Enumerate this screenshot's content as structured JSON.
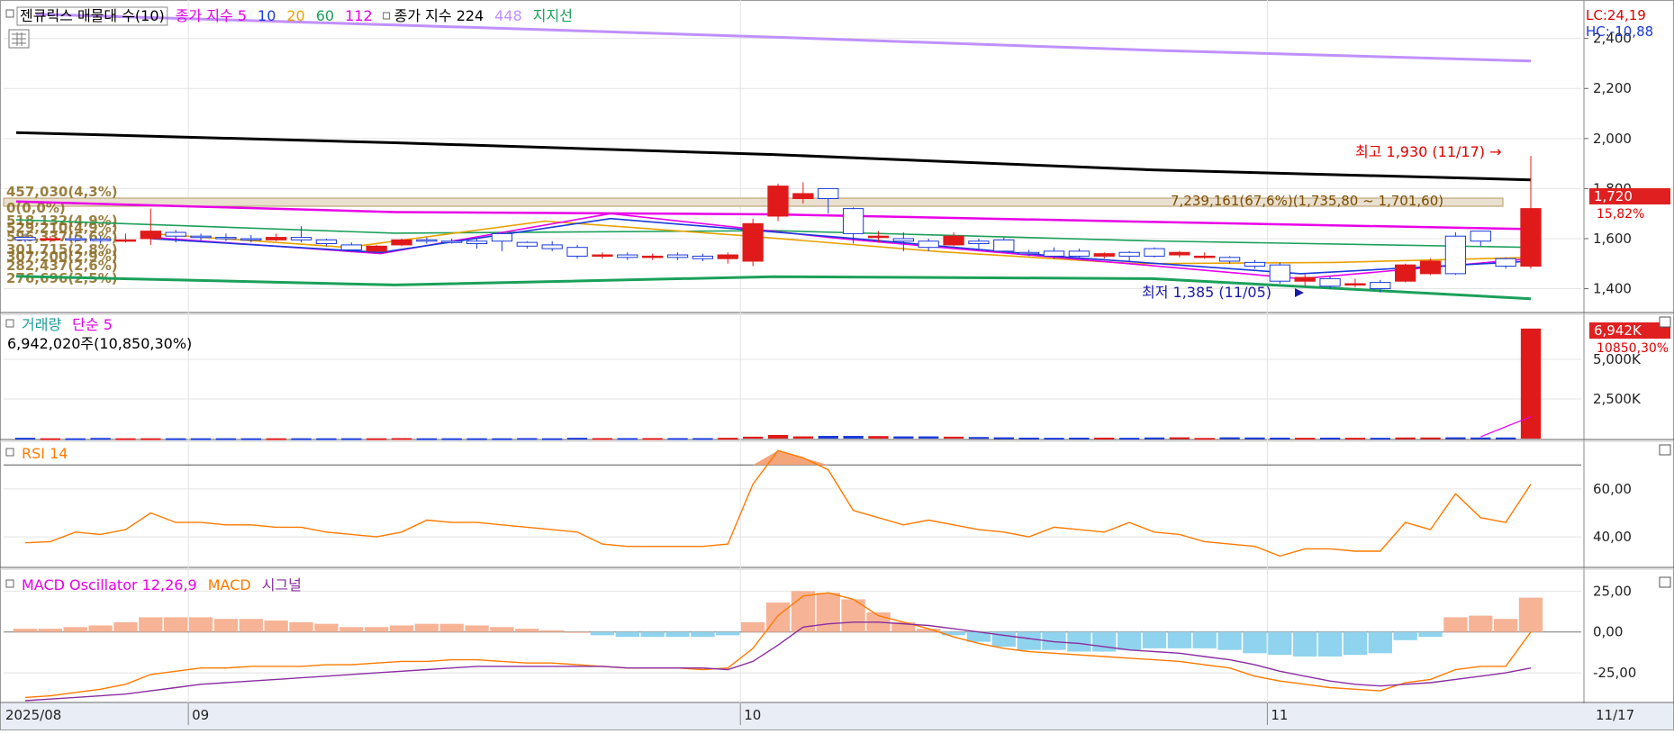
{
  "price_panel": {
    "legend": [
      {
        "text": "젠큐릭스 매물대 수(10)",
        "color": "#000000",
        "boxed": true
      },
      {
        "text": "종가 지수 5",
        "color": "#e800e8"
      },
      {
        "text": "10",
        "color": "#1a3adb"
      },
      {
        "text": "20",
        "color": "#e8a200"
      },
      {
        "text": "60",
        "color": "#1ba05a"
      },
      {
        "text": "112",
        "color": "#e800e8"
      },
      {
        "text": "종가 지수 224",
        "color": "#000000",
        "marker": true
      },
      {
        "text": "448",
        "color": "#c090ff"
      },
      {
        "text": "지지선",
        "color": "#1ba05a"
      }
    ],
    "lc_label": "LC:24,19",
    "hc_label": "HC:-10,88",
    "current_price": "1,720",
    "current_change": "15,82%",
    "high_note": "최고 1,930 (11/17) →",
    "low_note": "최저 1,385 (11/05)",
    "volume_profile_note": "7,239,161(67,6%)(1,735,80 ~ 1,701,60)",
    "volume_profile_labels": [
      "457,030(4,3%)",
      "0(0,0%)",
      "518,132(4,9%)",
      "529,210(4,9%)",
      "596,337(5,6%)",
      "301,715(2,8%)",
      "307,200(2,9%)",
      "282,437(2,6%)",
      "276,696(2,5%)"
    ]
  },
  "volume_panel": {
    "legend": [
      {
        "text": "거래량",
        "color": "#1a9a9a"
      },
      {
        "text": "단순 5",
        "color": "#e800e8"
      }
    ],
    "value_text": "6,942,020주(10,850,30%)",
    "badge": "6,942K",
    "badge_sub": "10850,30%"
  },
  "rsi_panel": {
    "legend": [
      {
        "text": "RSI 14",
        "color": "#ff7a00"
      }
    ]
  },
  "macd_panel": {
    "legend": [
      {
        "text": "MACD Oscillator 12,26,9",
        "color": "#e800e8"
      },
      {
        "text": "MACD",
        "color": "#ff7a00"
      },
      {
        "text": "시그널",
        "color": "#8a2da0"
      }
    ]
  },
  "x_axis": {
    "labels": [
      "2025/08",
      "09",
      "10",
      "11"
    ],
    "end_label": "11/17"
  },
  "chart_data": [
    {
      "type": "candlestick",
      "title": "젠큐릭스 일봉",
      "ylim": [
        1330,
        2460
      ],
      "y_ticks": [
        1400,
        1600,
        1800,
        2000,
        2200,
        2400
      ],
      "y_tick_labels": [
        "1,400",
        "1,600",
        "1,800",
        "2,000",
        "2,200",
        "2,400"
      ],
      "candles": [
        [
          1605,
          1595,
          1620,
          1585
        ],
        [
          1595,
          1600,
          1610,
          1585
        ],
        [
          1600,
          1595,
          1615,
          1585
        ],
        [
          1598,
          1592,
          1610,
          1580
        ],
        [
          1592,
          1595,
          1620,
          1585
        ],
        [
          1600,
          1630,
          1720,
          1575
        ],
        [
          1625,
          1610,
          1635,
          1585
        ],
        [
          1610,
          1605,
          1620,
          1585
        ],
        [
          1605,
          1600,
          1620,
          1590
        ],
        [
          1600,
          1595,
          1615,
          1585
        ],
        [
          1595,
          1605,
          1620,
          1590
        ],
        [
          1605,
          1595,
          1650,
          1585
        ],
        [
          1595,
          1580,
          1600,
          1570
        ],
        [
          1575,
          1555,
          1585,
          1545
        ],
        [
          1550,
          1570,
          1575,
          1545
        ],
        [
          1575,
          1595,
          1600,
          1570
        ],
        [
          1595,
          1590,
          1605,
          1580
        ],
        [
          1590,
          1588,
          1600,
          1580
        ],
        [
          1590,
          1580,
          1600,
          1560
        ],
        [
          1620,
          1590,
          1625,
          1550
        ],
        [
          1585,
          1570,
          1590,
          1560
        ],
        [
          1575,
          1560,
          1590,
          1550
        ],
        [
          1565,
          1530,
          1575,
          1520
        ],
        [
          1530,
          1535,
          1545,
          1520
        ],
        [
          1535,
          1525,
          1545,
          1515
        ],
        [
          1530,
          1530,
          1540,
          1515
        ],
        [
          1535,
          1525,
          1545,
          1515
        ],
        [
          1530,
          1520,
          1540,
          1510
        ],
        [
          1520,
          1535,
          1545,
          1500
        ],
        [
          1510,
          1660,
          1680,
          1490
        ],
        [
          1690,
          1810,
          1820,
          1670
        ],
        [
          1760,
          1780,
          1825,
          1740
        ],
        [
          1800,
          1760,
          1800,
          1700
        ],
        [
          1720,
          1620,
          1725,
          1580
        ],
        [
          1610,
          1610,
          1630,
          1585
        ],
        [
          1600,
          1590,
          1625,
          1550
        ],
        [
          1590,
          1565,
          1600,
          1550
        ],
        [
          1575,
          1610,
          1625,
          1570
        ],
        [
          1590,
          1580,
          1600,
          1560
        ],
        [
          1595,
          1550,
          1605,
          1545
        ],
        [
          1545,
          1540,
          1555,
          1530
        ],
        [
          1550,
          1530,
          1565,
          1520
        ],
        [
          1550,
          1530,
          1560,
          1525
        ],
        [
          1530,
          1540,
          1545,
          1520
        ],
        [
          1545,
          1530,
          1550,
          1510
        ],
        [
          1560,
          1530,
          1565,
          1525
        ],
        [
          1535,
          1545,
          1550,
          1525
        ],
        [
          1530,
          1530,
          1545,
          1520
        ],
        [
          1525,
          1510,
          1530,
          1500
        ],
        [
          1505,
          1490,
          1515,
          1480
        ],
        [
          1495,
          1430,
          1505,
          1420
        ],
        [
          1430,
          1445,
          1460,
          1410
        ],
        [
          1440,
          1410,
          1450,
          1400
        ],
        [
          1420,
          1420,
          1440,
          1405
        ],
        [
          1425,
          1400,
          1435,
          1385
        ],
        [
          1430,
          1495,
          1500,
          1425
        ],
        [
          1460,
          1510,
          1520,
          1455
        ],
        [
          1610,
          1460,
          1625,
          1455
        ],
        [
          1630,
          1590,
          1630,
          1570
        ],
        [
          1520,
          1490,
          1525,
          1480
        ],
        [
          1490,
          1720,
          1930,
          1480
        ]
      ],
      "series": [
        {
          "name": "448",
          "color": "#c090ff",
          "values": [
            2497,
            2452,
            2404,
            2352,
            2310
          ]
        },
        {
          "name": "224",
          "color": "#000000",
          "values": [
            2024,
            1983,
            1936,
            1875,
            1835
          ]
        },
        {
          "name": "112",
          "color": "#e800e8",
          "values": [
            1748,
            1706,
            1697,
            1667,
            1638
          ]
        },
        {
          "name": "60",
          "color": "#1ba05a",
          "values": [
            1675,
            1622,
            1632,
            1591,
            1565
          ]
        },
        {
          "name": "20",
          "color": "#e8a200",
          "values": [
            1620,
            1565,
            1670,
            1612,
            1548,
            1500,
            1505,
            1525
          ]
        },
        {
          "name": "5",
          "color": "#e800e8",
          "values": [
            1605,
            1540,
            1700,
            1600,
            1520,
            1440,
            1520
          ]
        },
        {
          "name": "10",
          "color": "#1a3adb",
          "values": [
            1600,
            1545,
            1680,
            1605,
            1525,
            1460,
            1510
          ]
        },
        {
          "name": "지지선",
          "color": "#1ba05a",
          "values": [
            1450,
            1415,
            1448,
            1440,
            1360
          ]
        }
      ]
    },
    {
      "type": "bar",
      "title": "거래량",
      "y_ticks": [
        2500,
        5000
      ],
      "y_tick_labels": [
        "2,500K",
        "5,000K"
      ],
      "ylim": [
        0,
        7500
      ],
      "values_k": [
        50,
        20,
        20,
        40,
        20,
        20,
        20,
        20,
        20,
        20,
        20,
        20,
        20,
        20,
        20,
        30,
        20,
        20,
        20,
        20,
        30,
        20,
        50,
        30,
        30,
        30,
        30,
        30,
        50,
        120,
        230,
        140,
        170,
        170,
        160,
        140,
        140,
        120,
        100,
        80,
        60,
        50,
        60,
        60,
        50,
        70,
        80,
        40,
        80,
        70,
        60,
        50,
        60,
        50,
        50,
        70,
        70,
        80,
        70,
        70,
        6942
      ]
    },
    {
      "type": "line",
      "title": "RSI 14",
      "ylim": [
        28,
        78
      ],
      "y_ticks": [
        40,
        60
      ],
      "y_tick_labels": [
        "40,00",
        "60,00"
      ],
      "values": [
        37.5,
        38,
        42,
        41,
        43,
        50,
        46,
        46,
        45,
        45,
        44,
        44,
        42,
        41,
        40,
        42,
        47,
        46,
        46,
        45,
        44,
        43,
        42,
        37,
        36,
        36,
        36,
        36,
        37,
        62,
        76,
        73,
        68,
        51,
        48,
        45,
        47,
        45,
        43,
        42,
        40,
        44,
        43,
        42,
        46,
        42,
        41,
        38,
        37,
        36,
        32,
        35,
        35,
        34,
        34,
        46,
        43,
        58,
        48,
        46,
        62
      ]
    },
    {
      "type": "bar",
      "title": "MACD Oscillator 12,26,9",
      "ylim": [
        -42,
        34
      ],
      "y_ticks": [
        -25,
        0,
        25
      ],
      "y_tick_labels": [
        "-25,00",
        "0,00",
        "25,00"
      ],
      "oscillator": [
        2,
        2,
        3,
        4,
        6,
        9,
        9,
        9,
        8,
        8,
        7,
        6,
        5,
        3,
        3,
        4,
        5,
        5,
        4,
        3,
        2,
        1,
        0,
        -2,
        -3,
        -3,
        -3,
        -3,
        -2,
        6,
        18,
        25,
        24,
        20,
        12,
        6,
        2,
        -2,
        -6,
        -9,
        -11,
        -11,
        -12,
        -12,
        -11,
        -10,
        -10,
        -10,
        -11,
        -13,
        -14,
        -15,
        -15,
        -14,
        -13,
        -5,
        -3,
        9,
        10,
        8,
        21
      ],
      "macd": [
        -40,
        -39,
        -37,
        -35,
        -32,
        -26,
        -24,
        -22,
        -22,
        -21,
        -21,
        -21,
        -20,
        -20,
        -19,
        -18,
        -18,
        -17,
        -17,
        -18,
        -19,
        -19,
        -20,
        -21,
        -22,
        -22,
        -22,
        -23,
        -22,
        -10,
        10,
        22,
        24,
        20,
        10,
        6,
        2,
        -3,
        -7,
        -10,
        -12,
        -13,
        -14,
        -15,
        -16,
        -17,
        -18,
        -20,
        -22,
        -27,
        -30,
        -32,
        -34,
        -35,
        -36,
        -31,
        -29,
        -23,
        -21,
        -21,
        0
      ],
      "signal": [
        -42,
        -41,
        -40,
        -39,
        -38,
        -36,
        -34,
        -32,
        -31,
        -30,
        -29,
        -28,
        -27,
        -26,
        -25,
        -24,
        -23,
        -22,
        -21,
        -21,
        -21,
        -21,
        -21,
        -21,
        -22,
        -22,
        -22,
        -22,
        -23,
        -18,
        -8,
        3,
        5,
        6,
        6,
        5,
        4,
        2,
        0,
        -2,
        -4,
        -6,
        -7,
        -9,
        -11,
        -12,
        -13,
        -15,
        -17,
        -20,
        -24,
        -27,
        -30,
        -32,
        -33,
        -32,
        -31,
        -29,
        -27,
        -25,
        -22
      ]
    }
  ]
}
